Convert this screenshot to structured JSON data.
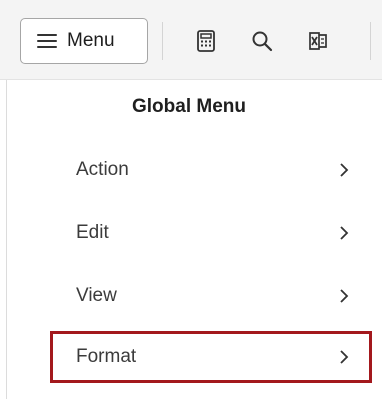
{
  "toolbar": {
    "menu_label": "Menu",
    "icons": [
      "calculator-icon",
      "search-icon",
      "excel-icon"
    ]
  },
  "panel": {
    "title": "Global Menu",
    "items": [
      {
        "label": "Action"
      },
      {
        "label": "Edit"
      },
      {
        "label": "View"
      },
      {
        "label": "Format",
        "highlighted": true
      }
    ]
  },
  "colors": {
    "highlight_border": "#a3181d",
    "toolbar_bg": "#f4f4f4",
    "text": "#333333"
  }
}
